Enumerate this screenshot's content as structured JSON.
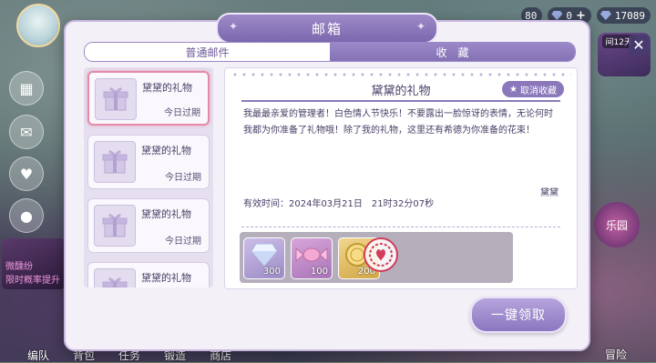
{
  "hud": {
    "value_partial_1": "80",
    "value_partial_2": "0",
    "gem_value": "17089",
    "plus": "+"
  },
  "right_panel": {
    "timer_text": "间12天",
    "paradise_text": "乐园"
  },
  "left_promo": {
    "title": "微醺纷",
    "subtitle": "限时概率提升"
  },
  "bottom_nav": {
    "items": [
      "编队",
      "背包",
      "任务",
      "锻造",
      "商店"
    ],
    "right_label": "冒险"
  },
  "mailbox": {
    "title": "邮箱",
    "tabs": [
      {
        "label": "普通邮件",
        "active": false
      },
      {
        "label": "收　藏",
        "active": true
      }
    ],
    "mails": [
      {
        "title": "黛黛的礼物",
        "expire": "今日过期",
        "selected": true
      },
      {
        "title": "黛黛的礼物",
        "expire": "今日过期",
        "selected": false
      },
      {
        "title": "黛黛的礼物",
        "expire": "今日过期",
        "selected": false
      },
      {
        "title": "黛黛的礼物",
        "expire": "",
        "selected": false
      }
    ],
    "detail": {
      "title": "黛黛的礼物",
      "unfavorite_label": "取消收藏",
      "body": "我最最亲爱的管理者！白色情人节快乐！不要露出一脸惊讶的表情，无论何时我都为你准备了礼物哦！除了我的礼物，这里还有希德为你准备的花束！",
      "sender": "黛黛",
      "validity": "有效时间：2024年03月21日　21时32分07秒",
      "rewards": [
        {
          "icon": "diamond-icon",
          "count": "300"
        },
        {
          "icon": "candy-icon",
          "count": "100"
        },
        {
          "icon": "coin-icon",
          "count": "200"
        }
      ]
    },
    "claim_all_label": "一键领取"
  }
}
